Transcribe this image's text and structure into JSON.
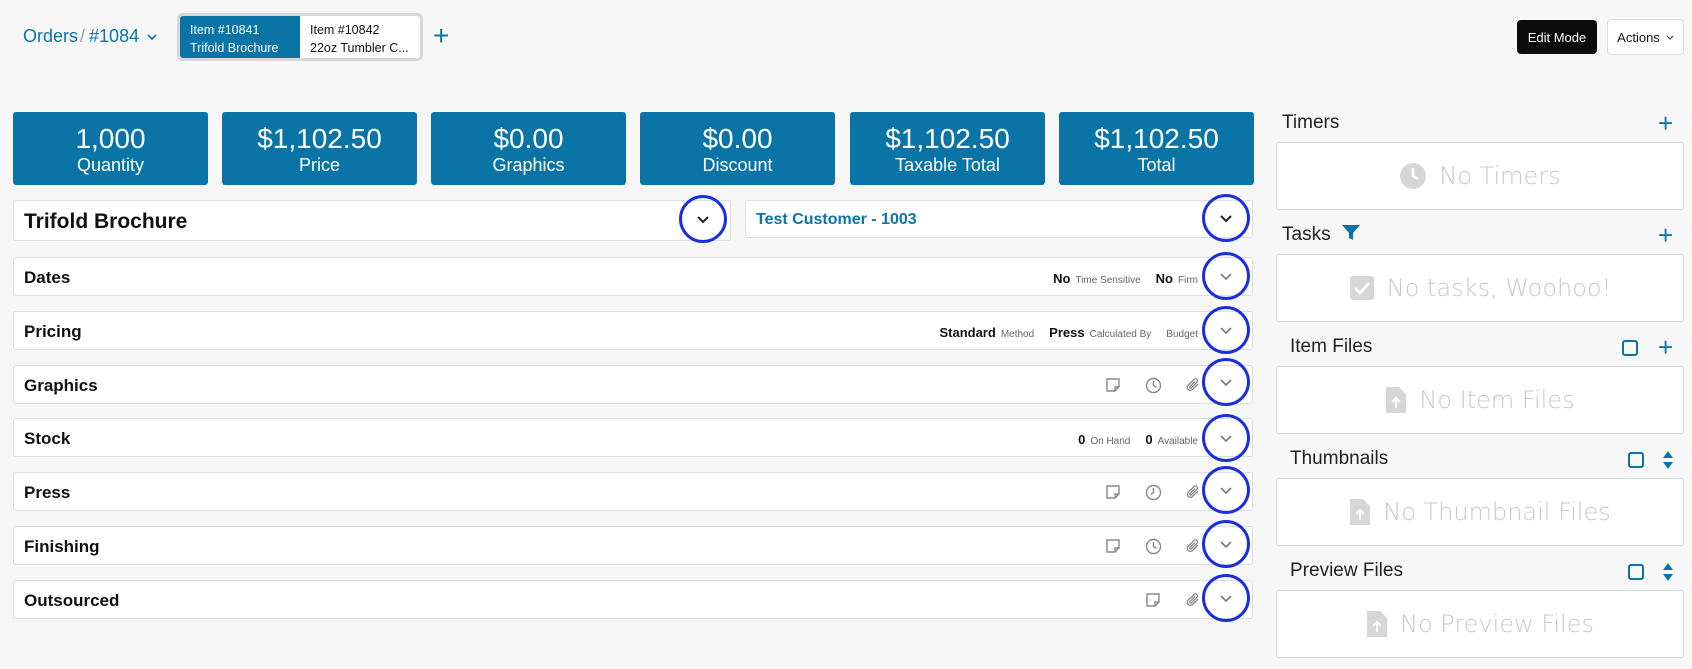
{
  "breadcrumb": {
    "orders": "Orders",
    "separator": "/",
    "order_number": "#1084",
    "chevron_icon": "chevron-down-icon"
  },
  "item_tabs": [
    {
      "line1": "Item #10841",
      "line2": "Trifold Brochure",
      "active": true
    },
    {
      "line1": "Item #10842",
      "line2": "22oz Tumbler C...",
      "active": false
    }
  ],
  "header": {
    "add_item_icon": "plus-icon",
    "edit_mode": "Edit Mode",
    "actions": "Actions"
  },
  "summary": [
    {
      "value": "1,000",
      "label": "Quantity"
    },
    {
      "value": "$1,102.50",
      "label": "Price"
    },
    {
      "value": "$0.00",
      "label": "Graphics"
    },
    {
      "value": "$0.00",
      "label": "Discount"
    },
    {
      "value": "$1,102.50",
      "label": "Taxable Total"
    },
    {
      "value": "$1,102.50",
      "label": "Total"
    }
  ],
  "item_name": "Trifold Brochure",
  "customer": "Test Customer - 1003",
  "sections": {
    "dates": {
      "title": "Dates",
      "v1": "No",
      "l1": "Time Sensitive",
      "v2": "No",
      "l2": "Firm"
    },
    "pricing": {
      "title": "Pricing",
      "v1": "Standard",
      "l1": "Method",
      "v2": "Press",
      "l2": "Calculated By",
      "l3": "Budget"
    },
    "graphics": {
      "title": "Graphics"
    },
    "stock": {
      "title": "Stock",
      "v1": "0",
      "l1": "On Hand",
      "v2": "0",
      "l2": "Available"
    },
    "press": {
      "title": "Press"
    },
    "finishing": {
      "title": "Finishing"
    },
    "outsourced": {
      "title": "Outsourced"
    }
  },
  "right_panel": {
    "timers": {
      "title": "Timers",
      "empty": "No Timers"
    },
    "tasks": {
      "title": "Tasks",
      "empty": "No tasks, Woohoo!"
    },
    "item_files": {
      "title": "Item Files",
      "empty": "No Item Files"
    },
    "thumbnails": {
      "title": "Thumbnails",
      "empty": "No Thumbnail Files"
    },
    "preview_files": {
      "title": "Preview Files",
      "empty": "No Preview Files"
    }
  },
  "colors": {
    "brand": "#0a74a6",
    "highlight_ring": "#1a2ee0",
    "dark_button": "#0b0b0b"
  }
}
